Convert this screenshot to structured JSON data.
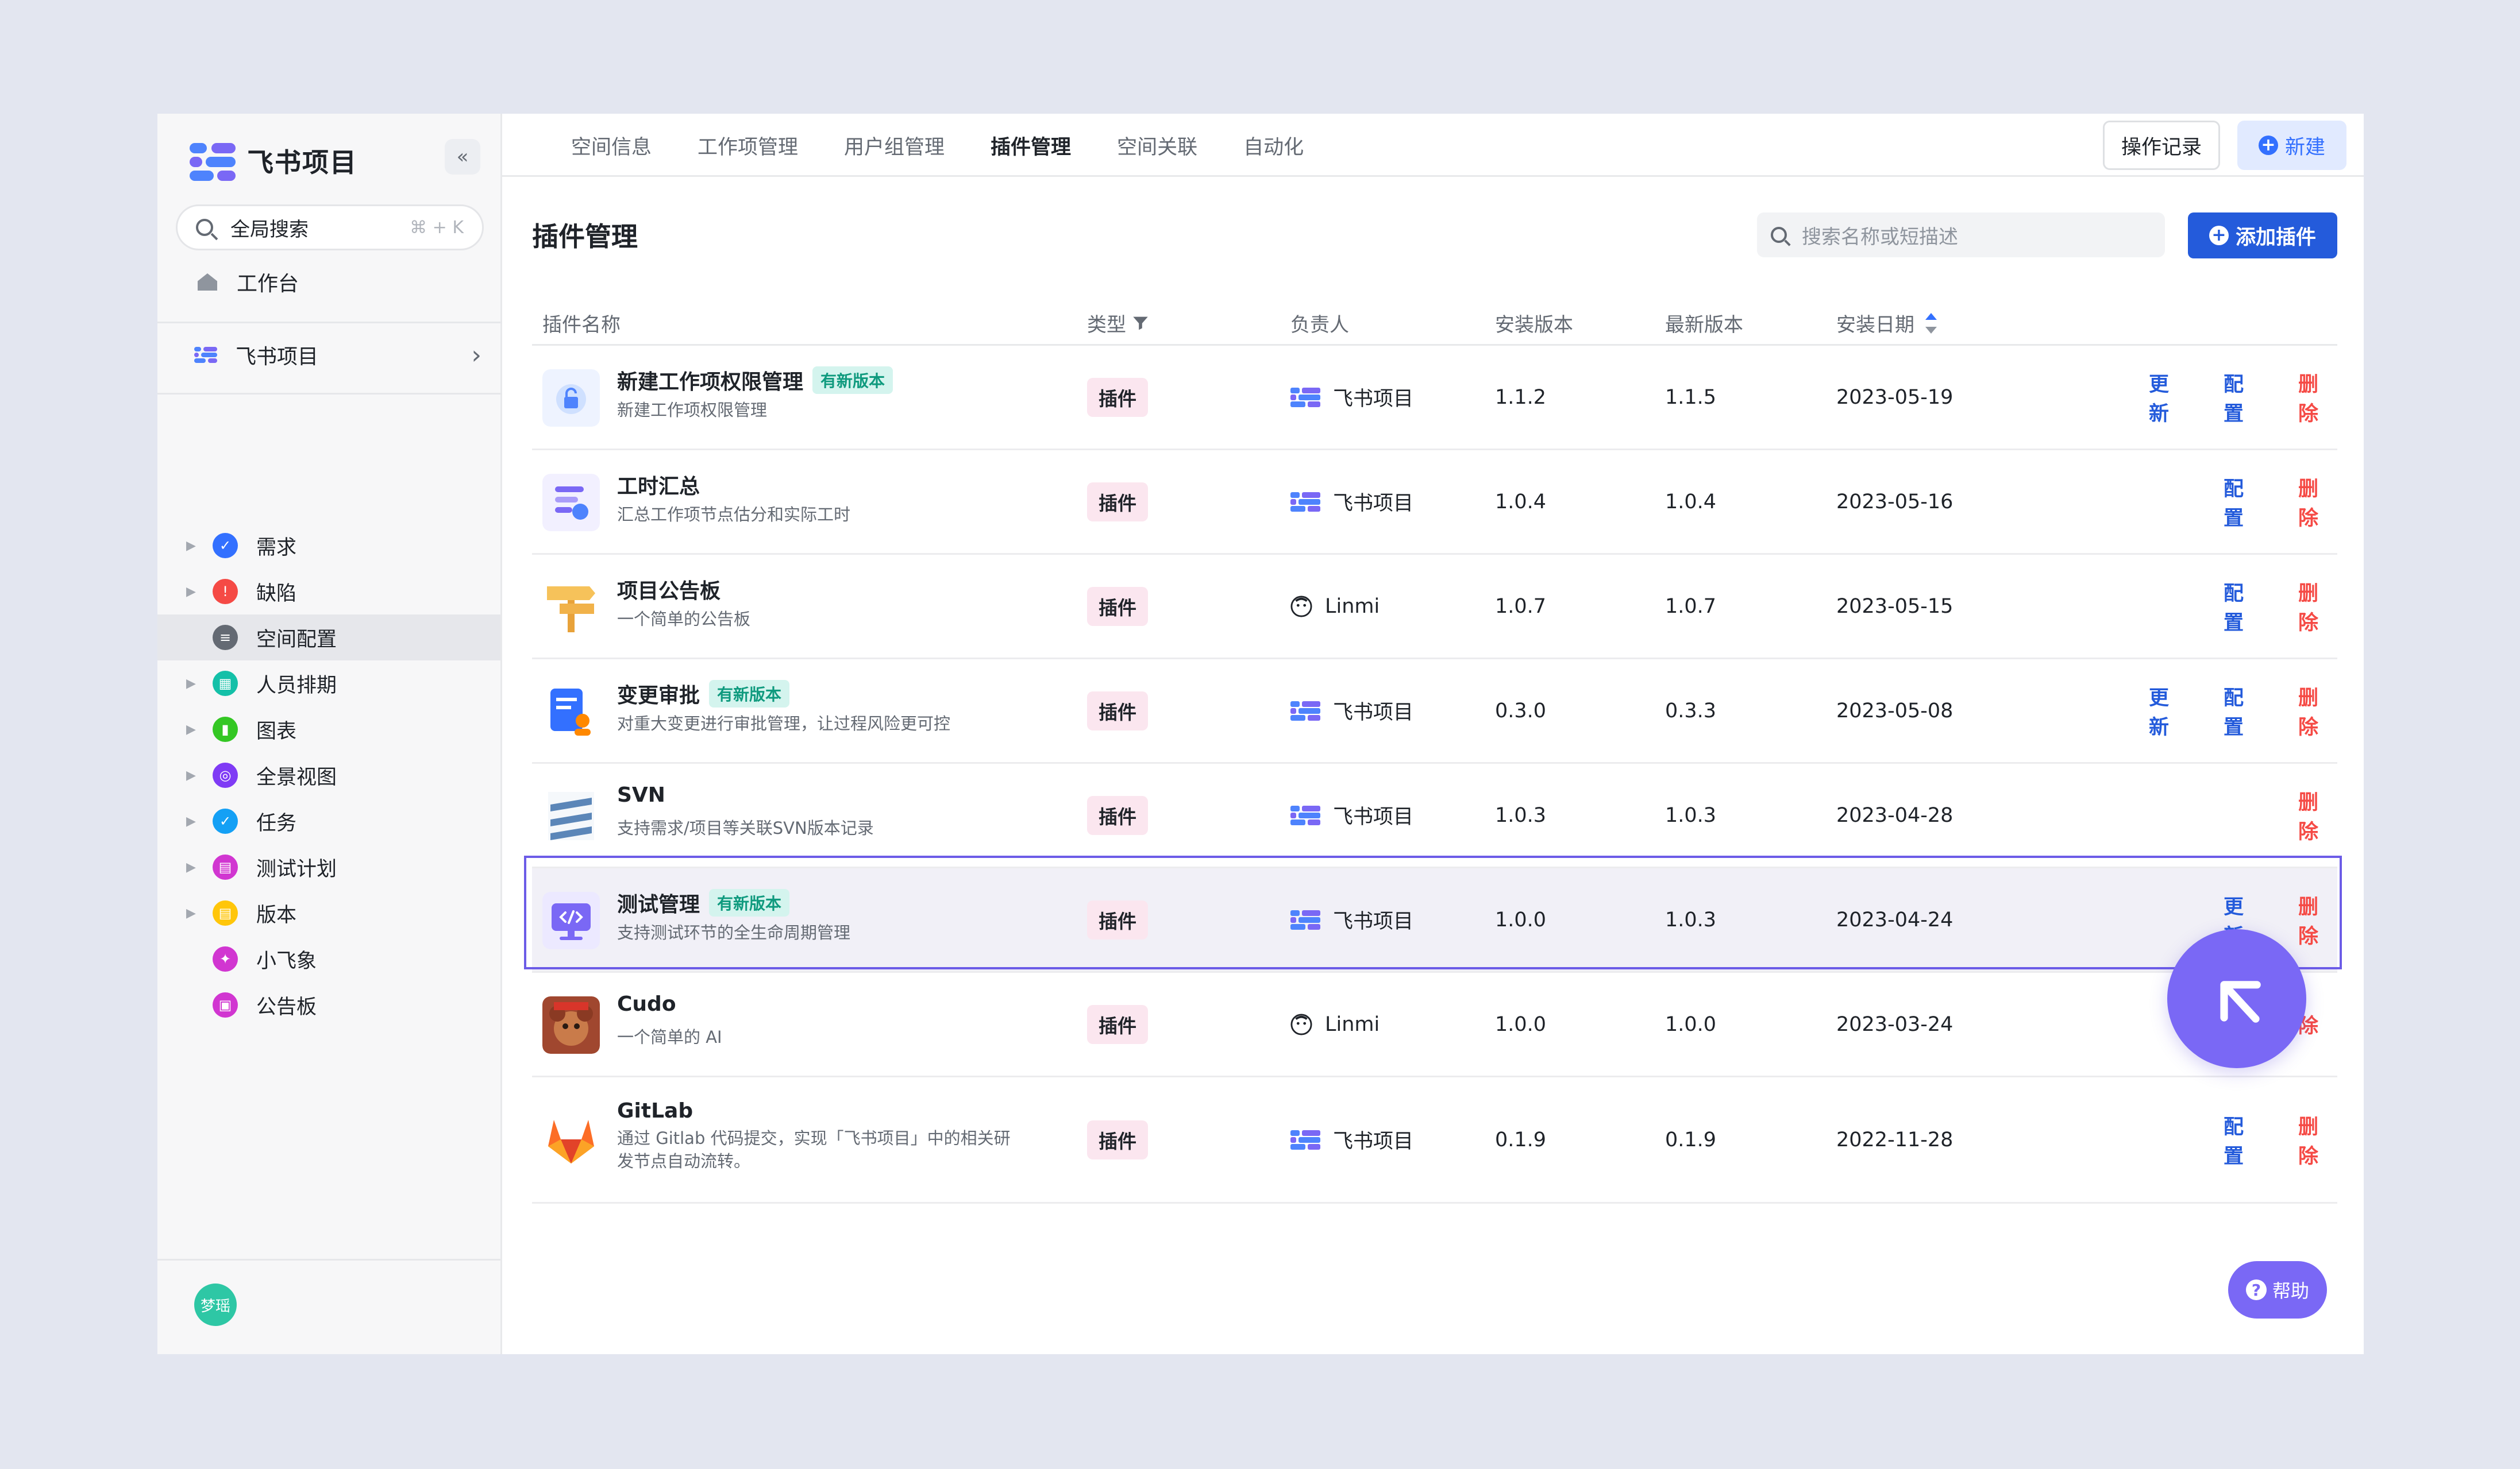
{
  "brand": {
    "name": "飞书项目"
  },
  "sidebar": {
    "collapse_icon": "«",
    "search_label": "全局搜索",
    "search_shortcut": "⌘ + K",
    "home_label": "工作台",
    "space_label": "飞书项目",
    "menu": [
      {
        "label": "需求",
        "color": "#3370ff",
        "glyph": "✓",
        "has_arrow": true
      },
      {
        "label": "缺陷",
        "color": "#f54a45",
        "glyph": "!",
        "has_arrow": true
      },
      {
        "label": "空间配置",
        "color": "#646a73",
        "glyph": "≡",
        "has_arrow": false,
        "active": true
      },
      {
        "label": "人员排期",
        "color": "#14c0a8",
        "glyph": "▦",
        "has_arrow": true
      },
      {
        "label": "图表",
        "color": "#34c724",
        "glyph": "▮",
        "has_arrow": true
      },
      {
        "label": "全景视图",
        "color": "#7f3bf5",
        "glyph": "◎",
        "has_arrow": true
      },
      {
        "label": "任务",
        "color": "#14a0f5",
        "glyph": "✓",
        "has_arrow": true
      },
      {
        "label": "测试计划",
        "color": "#d136d1",
        "glyph": "▤",
        "has_arrow": true
      },
      {
        "label": "版本",
        "color": "#ffc60a",
        "glyph": "▤",
        "has_arrow": true
      },
      {
        "label": "小飞象",
        "color": "#d136d1",
        "glyph": "✦",
        "has_arrow": false
      },
      {
        "label": "公告板",
        "color": "#d136d1",
        "glyph": "▣",
        "has_arrow": false
      }
    ],
    "user_avatar": "梦瑶"
  },
  "topbar": {
    "tabs": [
      "空间信息",
      "工作项管理",
      "用户组管理",
      "插件管理",
      "空间关联",
      "自动化"
    ],
    "active_tab": "插件管理",
    "log_button": "操作记录",
    "new_button": "新建"
  },
  "page": {
    "title": "插件管理",
    "search_placeholder": "搜索名称或短描述",
    "add_button": "添加插件"
  },
  "table": {
    "headers": {
      "name": "插件名称",
      "type": "类型",
      "owner": "负责人",
      "installed_version": "安装版本",
      "latest_version": "最新版本",
      "install_date": "安装日期"
    },
    "rows": [
      {
        "name": "新建工作项权限管理",
        "badge": "有新版本",
        "desc": "新建工作项权限管理",
        "type": "插件",
        "owner": "飞书项目",
        "owner_kind": "space",
        "installed": "1.1.2",
        "latest": "1.1.5",
        "date": "2023-05-19",
        "update": "更新",
        "config": "配置",
        "delete": "删除",
        "icon": "lock-icon"
      },
      {
        "name": "工时汇总",
        "badge": "",
        "desc": "汇总工作项节点估分和实际工时",
        "type": "插件",
        "owner": "飞书项目",
        "owner_kind": "space",
        "installed": "1.0.4",
        "latest": "1.0.4",
        "date": "2023-05-16",
        "update": "",
        "config": "配置",
        "delete": "删除",
        "icon": "timesheet-icon"
      },
      {
        "name": "项目公告板",
        "badge": "",
        "desc": "一个简单的公告板",
        "type": "插件",
        "owner": "Linmi",
        "owner_kind": "user",
        "installed": "1.0.7",
        "latest": "1.0.7",
        "date": "2023-05-15",
        "update": "",
        "config": "配置",
        "delete": "删除",
        "icon": "signpost-icon"
      },
      {
        "name": "变更审批",
        "badge": "有新版本",
        "desc": "对重大变更进行审批管理，让过程风险更可控",
        "type": "插件",
        "owner": "飞书项目",
        "owner_kind": "space",
        "installed": "0.3.0",
        "latest": "0.3.3",
        "date": "2023-05-08",
        "update": "更新",
        "config": "配置",
        "delete": "删除",
        "icon": "approval-icon"
      },
      {
        "name": "SVN",
        "badge": "",
        "desc": "支持需求/项目等关联SVN版本记录",
        "type": "插件",
        "owner": "飞书项目",
        "owner_kind": "space",
        "installed": "1.0.3",
        "latest": "1.0.3",
        "date": "2023-04-28",
        "update": "",
        "config": "",
        "delete": "删除",
        "icon": "svn-icon"
      },
      {
        "name": "测试管理",
        "badge": "有新版本",
        "desc": "支持测试环节的全生命周期管理",
        "type": "插件",
        "owner": "飞书项目",
        "owner_kind": "space",
        "installed": "1.0.0",
        "latest": "1.0.3",
        "date": "2023-04-24",
        "update": "更新",
        "config": "",
        "delete": "删除",
        "icon": "code-monitor-icon",
        "highlight": true
      },
      {
        "name": "Cudo",
        "badge": "",
        "desc": "一个简单的 AI",
        "type": "插件",
        "owner": "Linmi",
        "owner_kind": "user",
        "installed": "1.0.0",
        "latest": "1.0.0",
        "date": "2023-03-24",
        "update": "",
        "config": "",
        "delete": "除",
        "icon": "cudo-avatar-icon"
      },
      {
        "name": "GitLab",
        "badge": "",
        "desc": "通过 Gitlab 代码提交，实现「飞书项目」中的相关研发节点自动流转。",
        "type": "插件",
        "owner": "飞书项目",
        "owner_kind": "space",
        "installed": "0.1.9",
        "latest": "0.1.9",
        "date": "2022-11-28",
        "update": "",
        "config": "配置",
        "delete": "删除",
        "icon": "gitlab-icon"
      }
    ]
  },
  "help_button": "帮助",
  "colors": {
    "accent": "#245bdb",
    "danger": "#f54a45",
    "highlight": "#6c5ce7",
    "cursor": "#7a68f5"
  }
}
